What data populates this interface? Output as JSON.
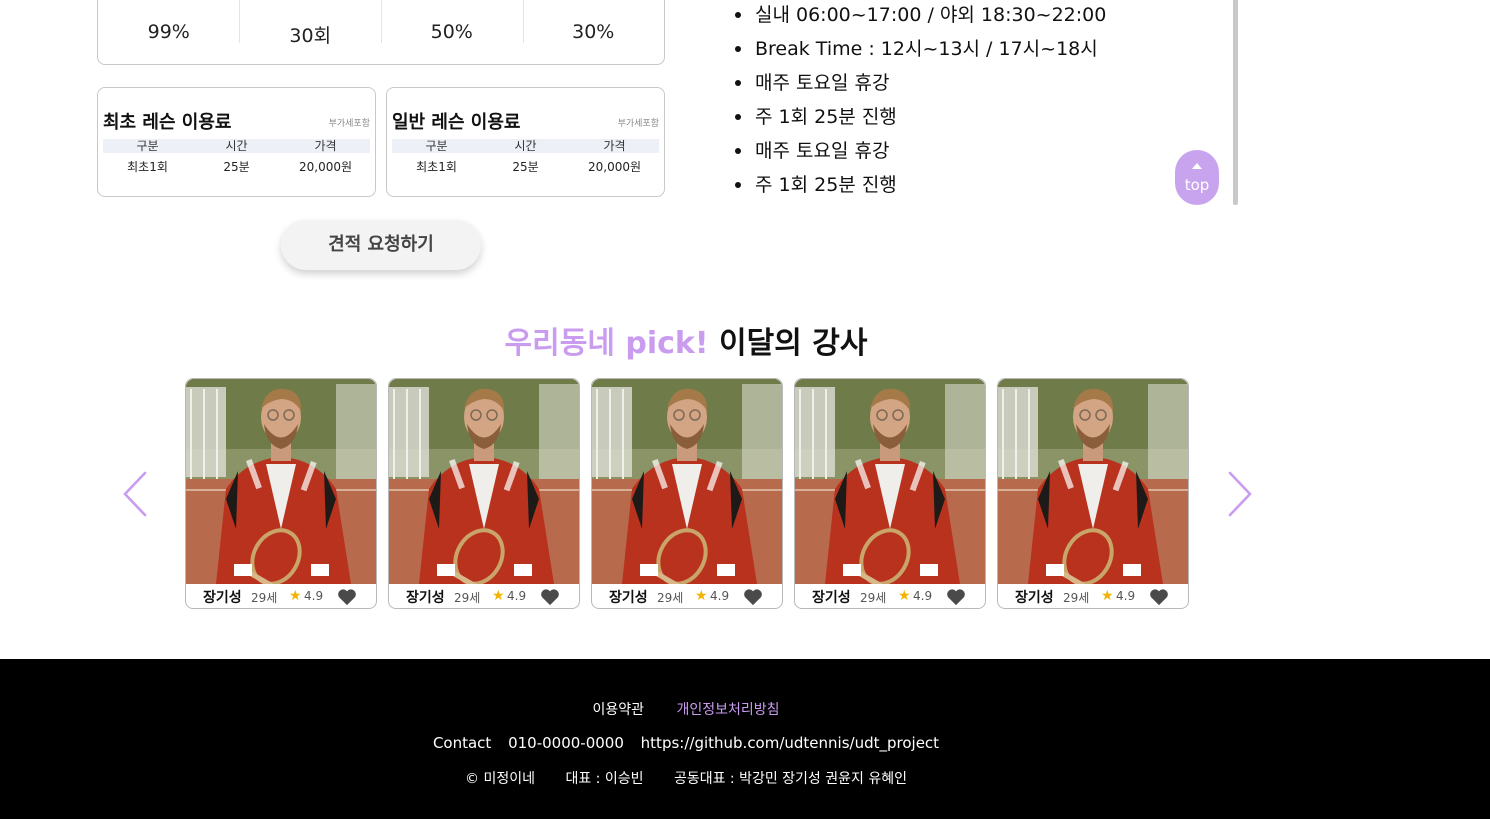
{
  "stats": {
    "values": [
      "99%",
      "30회",
      "50%",
      "30%"
    ]
  },
  "price_cards": [
    {
      "title": "최초 레슨 이용료",
      "vat": "부가세포함",
      "headers": [
        "구분",
        "시간",
        "가격"
      ],
      "row": [
        "최초1회",
        "25분",
        "20,000원"
      ]
    },
    {
      "title": "일반 레슨 이용료",
      "vat": "부가세포함",
      "headers": [
        "구분",
        "시간",
        "가격"
      ],
      "row": [
        "최초1회",
        "25분",
        "20,000원"
      ]
    }
  ],
  "quote_button": "견적 요청하기",
  "info_items": [
    "실내 06:00~17:00 / 야외 18:30~22:00",
    "Break Time : 12시~13시 / 17시~18시",
    "매주 토요일 휴강",
    "주 1회 25분 진행",
    "매주 토요일 휴강",
    "주 1회 25분 진행"
  ],
  "top_button": "top",
  "section": {
    "accent": "우리동네 pick!",
    "rest": "이달의 강사"
  },
  "instructors": [
    {
      "name": "장기성",
      "age": "29세",
      "rating": "4.9"
    },
    {
      "name": "장기성",
      "age": "29세",
      "rating": "4.9"
    },
    {
      "name": "장기성",
      "age": "29세",
      "rating": "4.9"
    },
    {
      "name": "장기성",
      "age": "29세",
      "rating": "4.9"
    },
    {
      "name": "장기성",
      "age": "29세",
      "rating": "4.9"
    }
  ],
  "footer": {
    "terms": "이용약관",
    "privacy": "개인정보처리방침",
    "contact_label": "Contact",
    "phone": "010-0000-0000",
    "github": "https://github.com/udtennis/udt_project",
    "copyright": "© 미정이네",
    "ceo": "대표 : 이승빈",
    "co_ceo": "공동대표 : 박강민 장기성 권윤지 유혜인"
  },
  "colors": {
    "accent": "#c99cf0",
    "top_button": "#c9a4ee",
    "footer_bg": "#000000",
    "star": "#f2b400"
  }
}
